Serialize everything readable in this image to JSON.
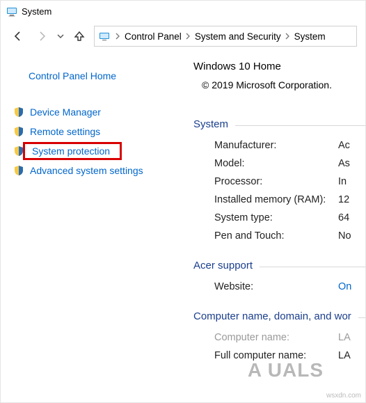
{
  "window": {
    "title": "System"
  },
  "breadcrumb": {
    "items": [
      "Control Panel",
      "System and Security",
      "System"
    ]
  },
  "sidebar": {
    "home": "Control Panel Home",
    "items": [
      {
        "label": "Device Manager"
      },
      {
        "label": "Remote settings"
      },
      {
        "label": "System protection"
      },
      {
        "label": "Advanced system settings"
      }
    ]
  },
  "content": {
    "edition": "Windows 10 Home",
    "copyright": "© 2019 Microsoft Corporation.",
    "groups": {
      "system": {
        "title": "System",
        "rows": [
          {
            "k": "Manufacturer:",
            "v": "Ac"
          },
          {
            "k": "Model:",
            "v": "As"
          },
          {
            "k": "Processor:",
            "v": "In"
          },
          {
            "k": "Installed memory (RAM):",
            "v": "12"
          },
          {
            "k": "System type:",
            "v": "64"
          },
          {
            "k": "Pen and Touch:",
            "v": "No"
          }
        ]
      },
      "support": {
        "title": "Acer support",
        "rows": [
          {
            "k": "Website:",
            "v": "On",
            "link": true
          }
        ]
      },
      "name": {
        "title": "Computer name, domain, and wor",
        "rows": [
          {
            "k": "Computer name:",
            "v": "LA",
            "disabled": true
          },
          {
            "k": "Full computer name:",
            "v": "LA"
          }
        ]
      }
    }
  },
  "watermark": "A   UALS",
  "source": "wsxdn.com"
}
